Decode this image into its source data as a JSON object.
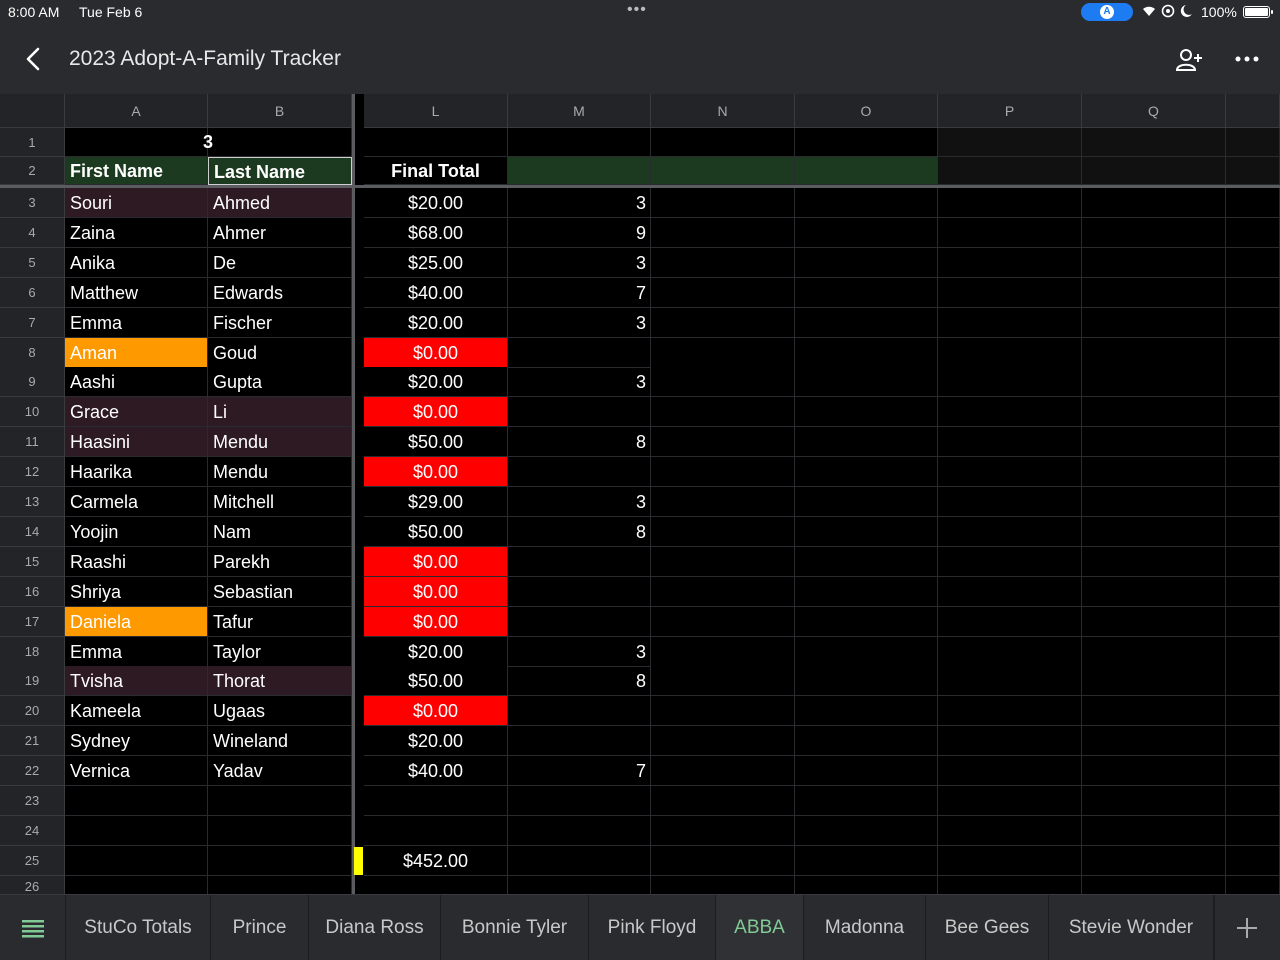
{
  "status_bar": {
    "time": "8:00 AM",
    "date": "Tue Feb 6",
    "battery": "100%",
    "pill_letter": "A"
  },
  "header": {
    "title": "2023 Adopt-A-Family Tracker"
  },
  "columns": [
    "A",
    "B",
    "L",
    "M",
    "N",
    "O",
    "P",
    "Q"
  ],
  "row1_value": "3",
  "headers": {
    "first": "First Name",
    "last": "Last Name",
    "total": "Final Total"
  },
  "rows": [
    {
      "first": "Souri",
      "last": "Ahmed",
      "total": "$20.00",
      "m": "3",
      "first_hl": "maroon",
      "last_hl": "maroon",
      "total_red": false
    },
    {
      "first": "Zaina",
      "last": "Ahmer",
      "total": "$68.00",
      "m": "9",
      "first_hl": "",
      "last_hl": "",
      "total_red": false
    },
    {
      "first": "Anika",
      "last": "De",
      "total": "$25.00",
      "m": "3",
      "first_hl": "",
      "last_hl": "",
      "total_red": false
    },
    {
      "first": "Matthew",
      "last": "Edwards",
      "total": "$40.00",
      "m": "7",
      "first_hl": "",
      "last_hl": "",
      "total_red": false
    },
    {
      "first": "Emma",
      "last": "Fischer",
      "total": "$20.00",
      "m": "3",
      "first_hl": "",
      "last_hl": "",
      "total_red": false
    },
    {
      "first": "Aman",
      "last": "Goud",
      "total": "$0.00",
      "m": "",
      "first_hl": "orange",
      "last_hl": "",
      "total_red": true
    },
    {
      "first": "Aashi",
      "last": "Gupta",
      "total": "$20.00",
      "m": "3",
      "first_hl": "",
      "last_hl": "",
      "total_red": false
    },
    {
      "first": "Grace",
      "last": "Li",
      "total": "$0.00",
      "m": "",
      "first_hl": "maroon",
      "last_hl": "maroon",
      "total_red": true
    },
    {
      "first": "Haasini",
      "last": "Mendu",
      "total": "$50.00",
      "m": "8",
      "first_hl": "maroon",
      "last_hl": "maroon",
      "total_red": false
    },
    {
      "first": "Haarika",
      "last": "Mendu",
      "total": "$0.00",
      "m": "",
      "first_hl": "",
      "last_hl": "",
      "total_red": true
    },
    {
      "first": "Carmela",
      "last": "Mitchell",
      "total": "$29.00",
      "m": "3",
      "first_hl": "",
      "last_hl": "",
      "total_red": false
    },
    {
      "first": "Yoojin",
      "last": "Nam",
      "total": "$50.00",
      "m": "8",
      "first_hl": "",
      "last_hl": "",
      "total_red": false
    },
    {
      "first": "Raashi",
      "last": "Parekh",
      "total": "$0.00",
      "m": "",
      "first_hl": "",
      "last_hl": "",
      "total_red": true
    },
    {
      "first": "Shriya",
      "last": "Sebastian",
      "total": "$0.00",
      "m": "",
      "first_hl": "",
      "last_hl": "",
      "total_red": true
    },
    {
      "first": "Daniela",
      "last": "Tafur",
      "total": "$0.00",
      "m": "",
      "first_hl": "orange",
      "last_hl": "",
      "total_red": true
    },
    {
      "first": "Emma",
      "last": "Taylor",
      "total": "$20.00",
      "m": "3",
      "first_hl": "",
      "last_hl": "",
      "total_red": false
    },
    {
      "first": "Tvisha",
      "last": "Thorat",
      "total": "$50.00",
      "m": "8",
      "first_hl": "maroon",
      "last_hl": "maroon",
      "total_red": false
    },
    {
      "first": "Kameela",
      "last": "Ugaas",
      "total": "$0.00",
      "m": "",
      "first_hl": "",
      "last_hl": "",
      "total_red": true
    },
    {
      "first": "Sydney",
      "last": "Wineland",
      "total": "$20.00",
      "m": "",
      "first_hl": "",
      "last_hl": "",
      "total_red": false
    },
    {
      "first": "Vernica",
      "last": "Yadav",
      "total": "$40.00",
      "m": "7",
      "first_hl": "",
      "last_hl": "",
      "total_red": false
    }
  ],
  "grand_total": "$452.00",
  "row_numbers": [
    "1",
    "2",
    "3",
    "4",
    "5",
    "6",
    "7",
    "8",
    "9",
    "10",
    "11",
    "12",
    "13",
    "14",
    "15",
    "16",
    "17",
    "18",
    "19",
    "20",
    "21",
    "22",
    "23",
    "24",
    "25",
    "26"
  ],
  "tabs": [
    "StuCo Totals",
    "Prince",
    "Diana Ross",
    "Bonnie Tyler",
    "Pink Floyd",
    "ABBA",
    "Madonna",
    "Bee Gees",
    "Stevie Wonder"
  ],
  "active_tab": "ABBA",
  "colors": {
    "maroon": "#2e1a22",
    "orange": "#ff9900",
    "red": "#ff0000",
    "header_green": "#1b3a1f",
    "yellow_marker": "#ffff00",
    "active_tab": "#81c995"
  }
}
